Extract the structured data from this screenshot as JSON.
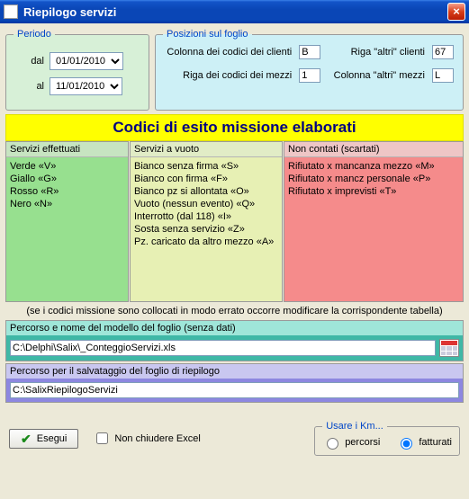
{
  "window": {
    "title": "Riepilogo servizi"
  },
  "periodo": {
    "legend": "Periodo",
    "dal_label": "dal",
    "al_label": "al",
    "dal_value": "01/01/2010",
    "al_value": "11/01/2010"
  },
  "posizioni": {
    "legend": "Posizioni sul foglio",
    "col_codici_clienti_label": "Colonna dei codici dei clienti",
    "col_codici_clienti_value": "B",
    "riga_altri_clienti_label": "Riga \"altri\" clienti",
    "riga_altri_clienti_value": "67",
    "riga_codici_mezzi_label": "Riga dei codici dei mezzi",
    "riga_codici_mezzi_value": "1",
    "col_altri_mezzi_label": "Colonna \"altri\" mezzi",
    "col_altri_mezzi_value": "L"
  },
  "banner": "Codici di esito missione elaborati",
  "lists": {
    "effettuati": {
      "header": "Servizi effettuati",
      "items": [
        "Verde «V»",
        "Giallo «G»",
        "Rosso «R»",
        "Nero «N»"
      ]
    },
    "vuoto": {
      "header": "Servizi a vuoto",
      "items": [
        "Bianco senza firma «S»",
        "Bianco con firma «F»",
        "Bianco pz si allontata «O»",
        "Vuoto (nessun evento) «Q»",
        "Interrotto (dal 118) «I»",
        "Sosta senza servizio «Z»",
        "Pz. caricato da altro mezzo «A»"
      ]
    },
    "scartati": {
      "header": "Non contati (scartati)",
      "items": [
        "Rifiutato x mancanza mezzo «M»",
        "Rifiutato x mancz personale «P»",
        "Rifiutato x imprevisti «T»"
      ]
    }
  },
  "note": "(se i codici missione sono collocati in modo errato occorre modificare la corrispondente tabella)",
  "modello": {
    "label": "Percorso e nome del modello del foglio (senza dati)",
    "value": "C:\\Delphi\\Salix\\_ConteggioServizi.xls"
  },
  "riepilogo": {
    "label": "Percorso per il salvataggio del foglio di riepilogo",
    "value": "C:\\SalixRiepilogoServizi"
  },
  "actions": {
    "esegui": "Esegui",
    "non_chiudere": "Non chiudere Excel"
  },
  "km": {
    "legend": "Usare i Km...",
    "percorsi": "percorsi",
    "fatturati": "fatturati",
    "selected": "fatturati"
  }
}
